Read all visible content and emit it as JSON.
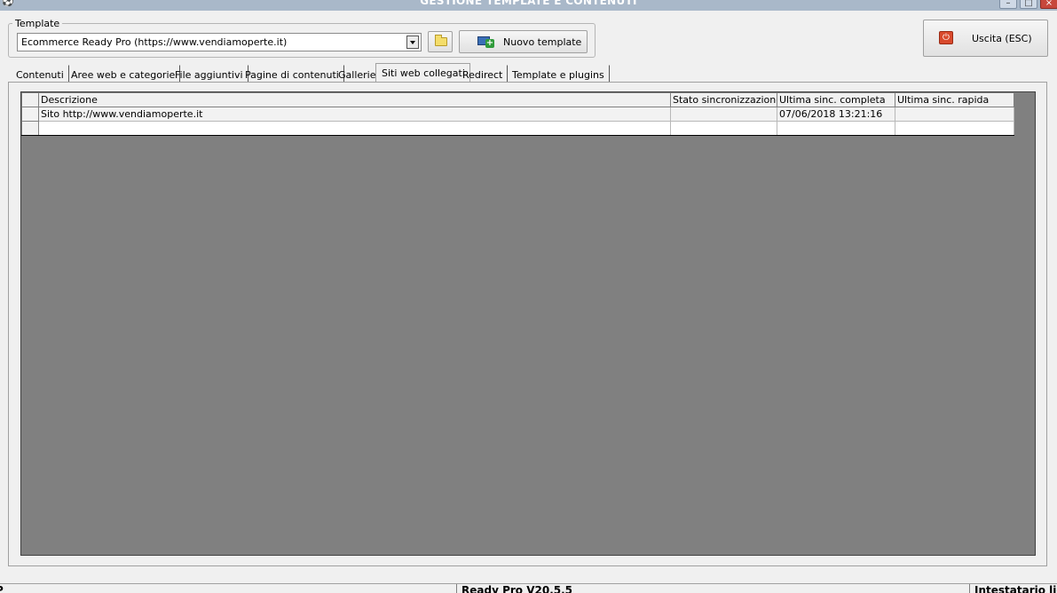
{
  "window": {
    "title": "GESTIONE TEMPLATE E CONTENUTI",
    "controls": {
      "minimize": "–",
      "maximize": "□",
      "close": "×"
    }
  },
  "template_group": {
    "legend": "Template",
    "selected_template": "Ecommerce Ready Pro (https://www.vendiamoperte.it)",
    "new_template_label": "Nuovo template"
  },
  "exit_button": {
    "label": "Uscita (ESC)"
  },
  "tabs": [
    {
      "label": "Contenuti"
    },
    {
      "label": "Aree web e categorie"
    },
    {
      "label": "File aggiuntivi"
    },
    {
      "label": "Pagine di contenuti"
    },
    {
      "label": "Gallerie"
    },
    {
      "label": "Siti web collegati",
      "active": true
    },
    {
      "label": "Redirect"
    },
    {
      "label": "Template e plugins"
    }
  ],
  "grid": {
    "columns": [
      "Descrizione",
      "Stato sincronizzazione",
      "Ultima sinc. completa",
      "Ultima sinc. rapida"
    ],
    "rows": [
      [
        "Sito http://www.vendiamoperte.it",
        "",
        "07/06/2018 13:21:16",
        ""
      ],
      [
        "",
        "",
        "",
        ""
      ]
    ]
  },
  "statusbar": {
    "left": "P",
    "version": "Ready Pro V20.5.5",
    "license": "Intestatario licenza"
  },
  "colors": {
    "title_bar": "#a9b8c9",
    "grid_background": "#808080",
    "window_background": "#f0f0f0"
  }
}
